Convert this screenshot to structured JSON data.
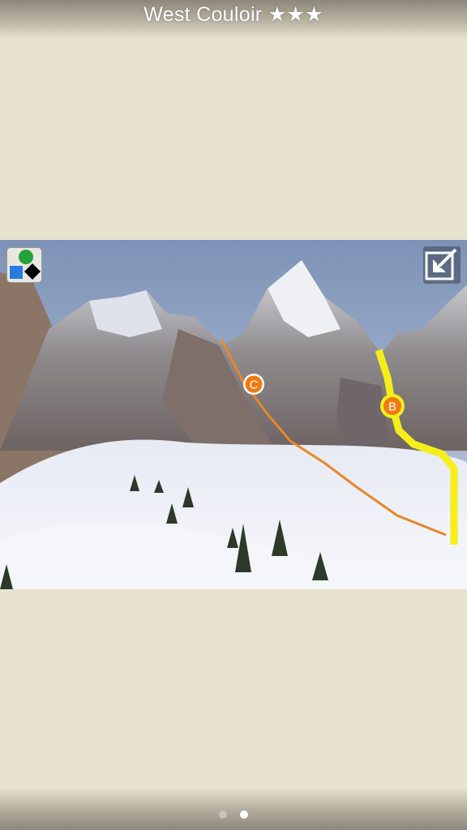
{
  "header": {
    "title": "West Couloir ★★★"
  },
  "photo": {
    "markers": [
      {
        "label": "C",
        "color": "#f07a10"
      },
      {
        "label": "B",
        "color": "#f07a10"
      }
    ],
    "route_colors": {
      "route_c": "#e8872a",
      "route_b": "#f5ee1a"
    }
  },
  "controls": {
    "legend_icon": "legend-shapes-icon",
    "expand_icon": "expand-arrow-icon"
  },
  "pager": {
    "pages": 2,
    "current": 2
  }
}
